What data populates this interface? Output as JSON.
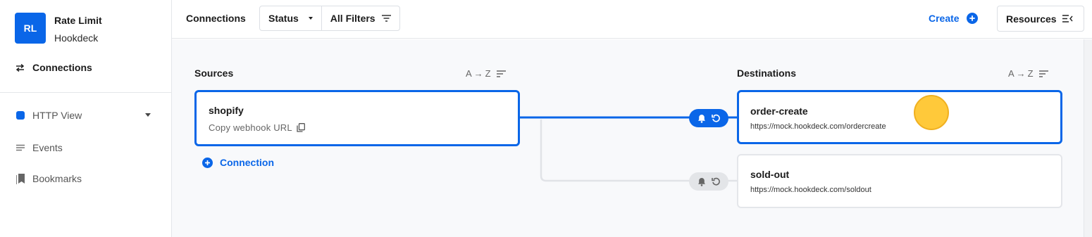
{
  "org": {
    "initials": "RL",
    "name": "Rate Limit",
    "workspace": "Hookdeck"
  },
  "sidebar": {
    "primary": {
      "label": "Connections",
      "icon": "swap-arrows-icon"
    },
    "items": [
      {
        "label": "HTTP View",
        "icon": "square-icon"
      },
      {
        "label": "Events",
        "icon": "lines-icon"
      },
      {
        "label": "Bookmarks",
        "icon": "bookmark-icon"
      }
    ]
  },
  "topbar": {
    "title": "Connections",
    "status_filter": "Status",
    "all_filters": "All Filters",
    "create_label": "Create",
    "resources_label": "Resources"
  },
  "sources": {
    "title": "Sources",
    "sort_from": "A",
    "sort_to": "Z",
    "cards": [
      {
        "name": "shopify",
        "copy_label": "Copy webhook URL"
      }
    ],
    "add_connection_label": "Connection"
  },
  "destinations": {
    "title": "Destinations",
    "sort_from": "A",
    "sort_to": "Z",
    "cards": [
      {
        "name": "order-create",
        "url": "https://mock.hookdeck.com/ordercreate"
      },
      {
        "name": "sold-out",
        "url": "https://mock.hookdeck.com/soldout"
      }
    ]
  },
  "colors": {
    "accent": "#0a66e8",
    "connector_inactive": "#e3e5e8",
    "cursor": "#ffc93a"
  }
}
